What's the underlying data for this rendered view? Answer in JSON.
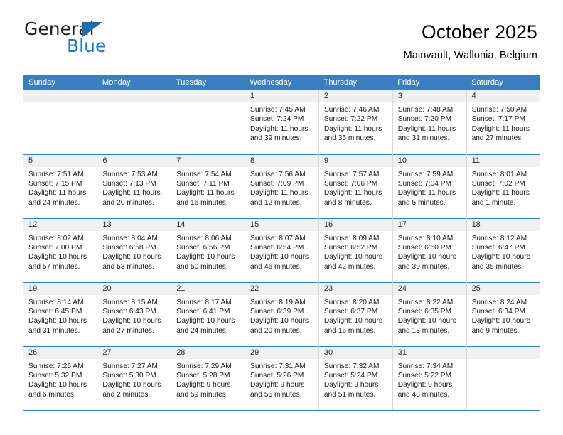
{
  "brand": {
    "name_top": "General",
    "name_bottom": "Blue",
    "triangle_color": "#1b6cb5",
    "blue_color": "#1b7ac4"
  },
  "header": {
    "title": "October 2025",
    "subtitle": "Mainvault, Wallonia, Belgium"
  },
  "theme": {
    "header_bar_color": "#3a7ebf",
    "daynum_band_color": "#f0f0f0"
  },
  "weekdays": [
    "Sunday",
    "Monday",
    "Tuesday",
    "Wednesday",
    "Thursday",
    "Friday",
    "Saturday"
  ],
  "weeks": [
    [
      {
        "empty": true
      },
      {
        "empty": true
      },
      {
        "empty": true
      },
      {
        "day": "1",
        "sunrise": "Sunrise: 7:45 AM",
        "sunset": "Sunset: 7:24 PM",
        "daylight_1": "Daylight: 11 hours",
        "daylight_2": "and 39 minutes."
      },
      {
        "day": "2",
        "sunrise": "Sunrise: 7:46 AM",
        "sunset": "Sunset: 7:22 PM",
        "daylight_1": "Daylight: 11 hours",
        "daylight_2": "and 35 minutes."
      },
      {
        "day": "3",
        "sunrise": "Sunrise: 7:48 AM",
        "sunset": "Sunset: 7:20 PM",
        "daylight_1": "Daylight: 11 hours",
        "daylight_2": "and 31 minutes."
      },
      {
        "day": "4",
        "sunrise": "Sunrise: 7:50 AM",
        "sunset": "Sunset: 7:17 PM",
        "daylight_1": "Daylight: 11 hours",
        "daylight_2": "and 27 minutes."
      }
    ],
    [
      {
        "day": "5",
        "sunrise": "Sunrise: 7:51 AM",
        "sunset": "Sunset: 7:15 PM",
        "daylight_1": "Daylight: 11 hours",
        "daylight_2": "and 24 minutes."
      },
      {
        "day": "6",
        "sunrise": "Sunrise: 7:53 AM",
        "sunset": "Sunset: 7:13 PM",
        "daylight_1": "Daylight: 11 hours",
        "daylight_2": "and 20 minutes."
      },
      {
        "day": "7",
        "sunrise": "Sunrise: 7:54 AM",
        "sunset": "Sunset: 7:11 PM",
        "daylight_1": "Daylight: 11 hours",
        "daylight_2": "and 16 minutes."
      },
      {
        "day": "8",
        "sunrise": "Sunrise: 7:56 AM",
        "sunset": "Sunset: 7:09 PM",
        "daylight_1": "Daylight: 11 hours",
        "daylight_2": "and 12 minutes."
      },
      {
        "day": "9",
        "sunrise": "Sunrise: 7:57 AM",
        "sunset": "Sunset: 7:06 PM",
        "daylight_1": "Daylight: 11 hours",
        "daylight_2": "and 8 minutes."
      },
      {
        "day": "10",
        "sunrise": "Sunrise: 7:59 AM",
        "sunset": "Sunset: 7:04 PM",
        "daylight_1": "Daylight: 11 hours",
        "daylight_2": "and 5 minutes."
      },
      {
        "day": "11",
        "sunrise": "Sunrise: 8:01 AM",
        "sunset": "Sunset: 7:02 PM",
        "daylight_1": "Daylight: 11 hours",
        "daylight_2": "and 1 minute."
      }
    ],
    [
      {
        "day": "12",
        "sunrise": "Sunrise: 8:02 AM",
        "sunset": "Sunset: 7:00 PM",
        "daylight_1": "Daylight: 10 hours",
        "daylight_2": "and 57 minutes."
      },
      {
        "day": "13",
        "sunrise": "Sunrise: 8:04 AM",
        "sunset": "Sunset: 6:58 PM",
        "daylight_1": "Daylight: 10 hours",
        "daylight_2": "and 53 minutes."
      },
      {
        "day": "14",
        "sunrise": "Sunrise: 8:06 AM",
        "sunset": "Sunset: 6:56 PM",
        "daylight_1": "Daylight: 10 hours",
        "daylight_2": "and 50 minutes."
      },
      {
        "day": "15",
        "sunrise": "Sunrise: 8:07 AM",
        "sunset": "Sunset: 6:54 PM",
        "daylight_1": "Daylight: 10 hours",
        "daylight_2": "and 46 minutes."
      },
      {
        "day": "16",
        "sunrise": "Sunrise: 8:09 AM",
        "sunset": "Sunset: 6:52 PM",
        "daylight_1": "Daylight: 10 hours",
        "daylight_2": "and 42 minutes."
      },
      {
        "day": "17",
        "sunrise": "Sunrise: 8:10 AM",
        "sunset": "Sunset: 6:50 PM",
        "daylight_1": "Daylight: 10 hours",
        "daylight_2": "and 39 minutes."
      },
      {
        "day": "18",
        "sunrise": "Sunrise: 8:12 AM",
        "sunset": "Sunset: 6:47 PM",
        "daylight_1": "Daylight: 10 hours",
        "daylight_2": "and 35 minutes."
      }
    ],
    [
      {
        "day": "19",
        "sunrise": "Sunrise: 8:14 AM",
        "sunset": "Sunset: 6:45 PM",
        "daylight_1": "Daylight: 10 hours",
        "daylight_2": "and 31 minutes."
      },
      {
        "day": "20",
        "sunrise": "Sunrise: 8:15 AM",
        "sunset": "Sunset: 6:43 PM",
        "daylight_1": "Daylight: 10 hours",
        "daylight_2": "and 27 minutes."
      },
      {
        "day": "21",
        "sunrise": "Sunrise: 8:17 AM",
        "sunset": "Sunset: 6:41 PM",
        "daylight_1": "Daylight: 10 hours",
        "daylight_2": "and 24 minutes."
      },
      {
        "day": "22",
        "sunrise": "Sunrise: 8:19 AM",
        "sunset": "Sunset: 6:39 PM",
        "daylight_1": "Daylight: 10 hours",
        "daylight_2": "and 20 minutes."
      },
      {
        "day": "23",
        "sunrise": "Sunrise: 8:20 AM",
        "sunset": "Sunset: 6:37 PM",
        "daylight_1": "Daylight: 10 hours",
        "daylight_2": "and 16 minutes."
      },
      {
        "day": "24",
        "sunrise": "Sunrise: 8:22 AM",
        "sunset": "Sunset: 6:35 PM",
        "daylight_1": "Daylight: 10 hours",
        "daylight_2": "and 13 minutes."
      },
      {
        "day": "25",
        "sunrise": "Sunrise: 8:24 AM",
        "sunset": "Sunset: 6:34 PM",
        "daylight_1": "Daylight: 10 hours",
        "daylight_2": "and 9 minutes."
      }
    ],
    [
      {
        "day": "26",
        "sunrise": "Sunrise: 7:26 AM",
        "sunset": "Sunset: 5:32 PM",
        "daylight_1": "Daylight: 10 hours",
        "daylight_2": "and 6 minutes."
      },
      {
        "day": "27",
        "sunrise": "Sunrise: 7:27 AM",
        "sunset": "Sunset: 5:30 PM",
        "daylight_1": "Daylight: 10 hours",
        "daylight_2": "and 2 minutes."
      },
      {
        "day": "28",
        "sunrise": "Sunrise: 7:29 AM",
        "sunset": "Sunset: 5:28 PM",
        "daylight_1": "Daylight: 9 hours",
        "daylight_2": "and 59 minutes."
      },
      {
        "day": "29",
        "sunrise": "Sunrise: 7:31 AM",
        "sunset": "Sunset: 5:26 PM",
        "daylight_1": "Daylight: 9 hours",
        "daylight_2": "and 55 minutes."
      },
      {
        "day": "30",
        "sunrise": "Sunrise: 7:32 AM",
        "sunset": "Sunset: 5:24 PM",
        "daylight_1": "Daylight: 9 hours",
        "daylight_2": "and 51 minutes."
      },
      {
        "day": "31",
        "sunrise": "Sunrise: 7:34 AM",
        "sunset": "Sunset: 5:22 PM",
        "daylight_1": "Daylight: 9 hours",
        "daylight_2": "and 48 minutes."
      },
      {
        "empty": true
      }
    ]
  ]
}
